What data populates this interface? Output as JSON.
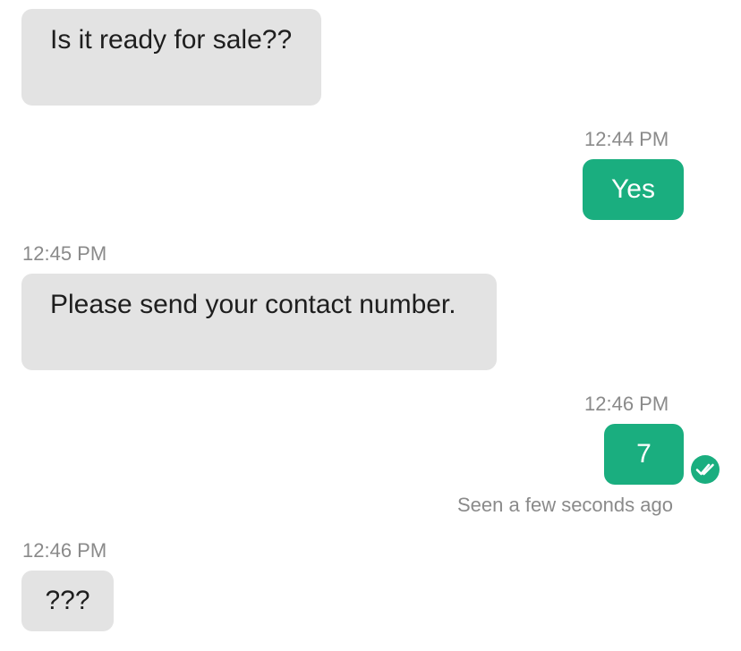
{
  "messages": [
    {
      "direction": "incoming",
      "time": "",
      "text": "Is it ready for sale??"
    },
    {
      "direction": "outgoing",
      "time": "12:44 PM",
      "text": "Yes"
    },
    {
      "direction": "incoming",
      "time": "12:45 PM",
      "text": "Please send your contact number."
    },
    {
      "direction": "outgoing",
      "time": "12:46 PM",
      "text": "7",
      "status": "Seen a few seconds ago",
      "status_icon": "double-check-icon"
    },
    {
      "direction": "incoming",
      "time": "12:46 PM",
      "text": "???"
    }
  ],
  "colors": {
    "outgoing_bubble": "#1aae7f",
    "incoming_bubble": "#e3e3e3",
    "timestamp": "#8a8a8a"
  }
}
